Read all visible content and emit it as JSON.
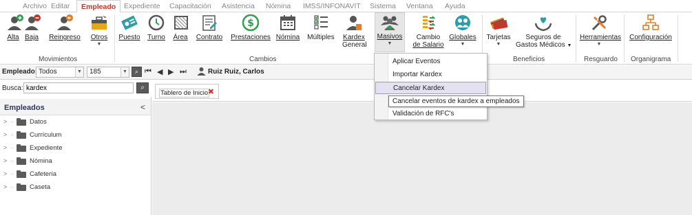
{
  "menu": {
    "tabs": [
      "Archivo",
      "Editar",
      "Empleado",
      "Expediente",
      "Capacitación",
      "Asistencia",
      "Nómina",
      "IMSS/INFONAVIT",
      "Sistema",
      "Ventana",
      "Ayuda"
    ],
    "active": "Empleado"
  },
  "ribbon": {
    "movimientos": {
      "label": "Movimientos",
      "alta": "Alta",
      "baja": "Baja",
      "reingreso": "Reingreso",
      "otros": "Otros"
    },
    "cambios": {
      "label": "Cambios",
      "puesto": "Puesto",
      "turno": "Turno",
      "area": "Área",
      "contrato": "Contrato",
      "prestaciones": "Prestaciones",
      "nomina": "Nómina",
      "multiples": "Múltiples",
      "kardex_general_1": "Kardex",
      "kardex_general_2": "General",
      "masivos": "Masivos",
      "cambio_salario_1": "Cambio",
      "cambio_salario_2": "de Salario",
      "globales": "Globales"
    },
    "beneficios": {
      "label": "Beneficios",
      "tarjetas": "Tarjetas",
      "seguros_1": "Seguros de",
      "seguros_2": "Gastos Médicos"
    },
    "resguardo": {
      "label": "Resguardo",
      "herramientas": "Herramientas"
    },
    "organigrama": {
      "label": "Organigrama",
      "configuracion": "Configuración"
    }
  },
  "toolbar": {
    "empleado_label": "Empleado:",
    "filter_value": "Todos",
    "number_value": "185",
    "employee_name": "Ruiz Ruiz, Carlos"
  },
  "search": {
    "label": "Busca:",
    "value": "kardex"
  },
  "left_panel": {
    "title": "Empleados",
    "items": [
      "Datos",
      "Currículum",
      "Expediente",
      "Nómina",
      "Cafetería",
      "Caseta"
    ]
  },
  "main": {
    "tab_label": "Tablero de Inicio"
  },
  "dropdown": {
    "items": [
      "Aplicar Eventos",
      "Importar Kardex",
      "Cancelar Kardex",
      "C",
      "Validación de RFC's"
    ]
  },
  "tooltip": "Cancelar eventos de kardex a empleados",
  "colors": {
    "accent": "#c0392b",
    "green": "#2e9e4f",
    "orange": "#e67e22",
    "dark_icon": "#555555",
    "teal": "#2a9fa8",
    "selected_bg": "#e4e2f0"
  }
}
